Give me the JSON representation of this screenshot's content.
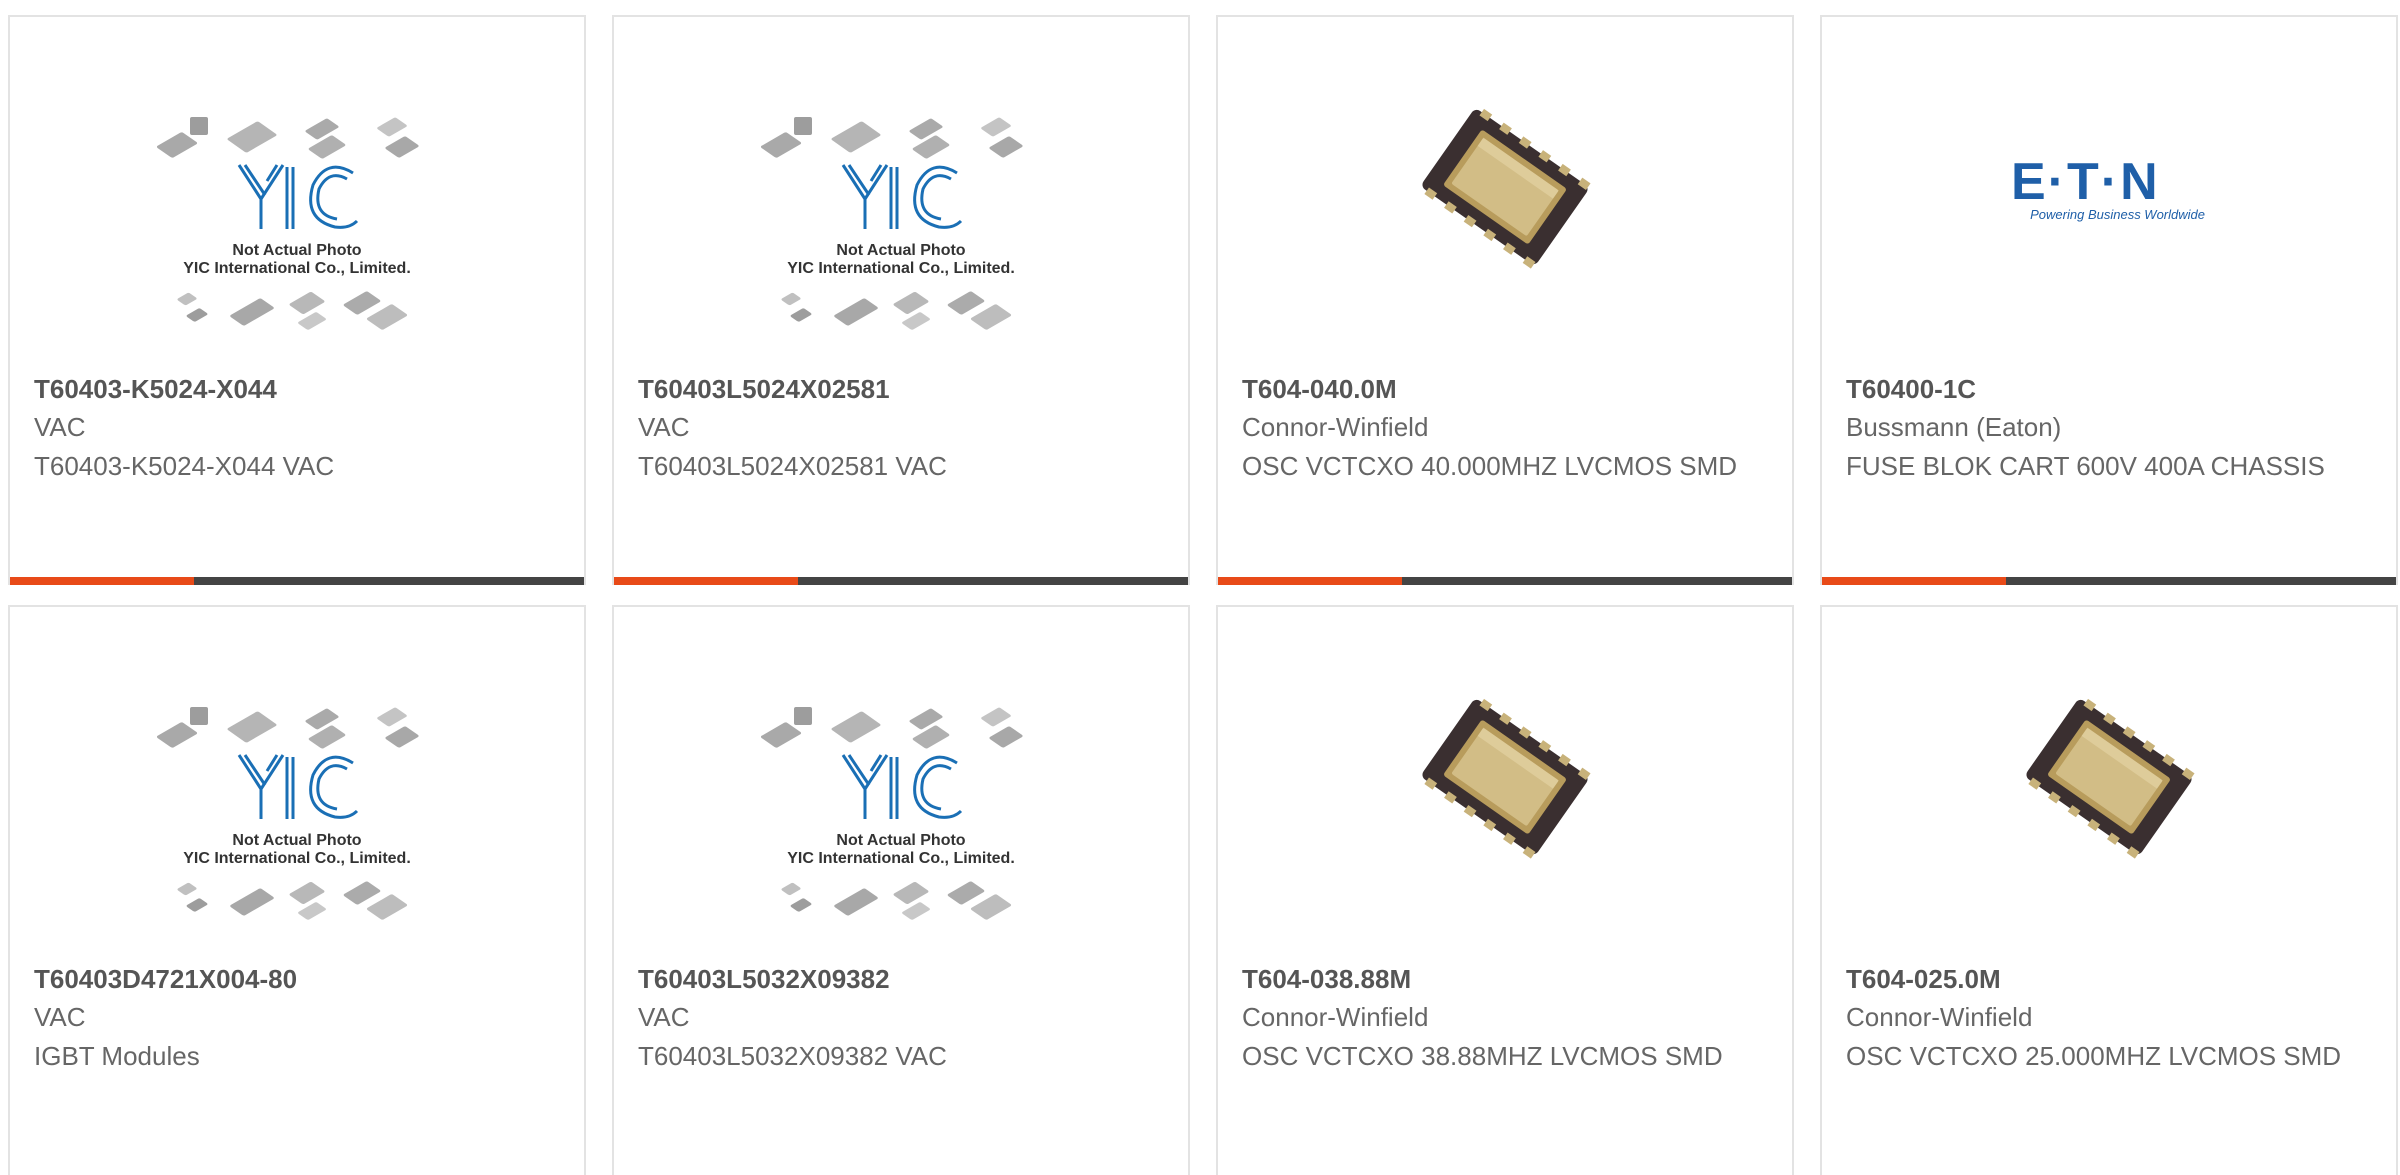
{
  "products": [
    {
      "part": "T60403-K5024-X044",
      "maker": "VAC",
      "desc": "T60403-K5024-X044 VAC",
      "image": "yic-placeholder"
    },
    {
      "part": "T60403L5024X02581",
      "maker": "VAC",
      "desc": "T60403L5024X02581 VAC",
      "image": "yic-placeholder"
    },
    {
      "part": "T604-040.0M",
      "maker": "Connor-Winfield",
      "desc": "OSC VCTCXO 40.000MHZ LVCMOS SMD",
      "image": "oscillator"
    },
    {
      "part": "T60400-1C",
      "maker": "Bussmann (Eaton)",
      "desc": "FUSE BLOK CART 600V 400A CHASSIS",
      "image": "eaton-logo"
    },
    {
      "part": "T60403D4721X004-80",
      "maker": "VAC",
      "desc": "IGBT Modules",
      "image": "yic-placeholder"
    },
    {
      "part": "T60403L5032X09382",
      "maker": "VAC",
      "desc": "T60403L5032X09382 VAC",
      "image": "yic-placeholder"
    },
    {
      "part": "T604-038.88M",
      "maker": "Connor-Winfield",
      "desc": "OSC VCTCXO 38.88MHZ LVCMOS SMD",
      "image": "oscillator"
    },
    {
      "part": "T604-025.0M",
      "maker": "Connor-Winfield",
      "desc": "OSC VCTCXO 25.000MHZ LVCMOS SMD",
      "image": "oscillator"
    }
  ],
  "placeholder": {
    "brand": "YIC",
    "line1": "Not Actual Photo",
    "line2": "YIC International Co., Limited."
  },
  "eaton": {
    "brand": "E·T·N",
    "tagline": "Powering Business Worldwide"
  },
  "colors": {
    "accent": "#e84a18",
    "bar": "#444444",
    "yic_blue": "#1a6fb5",
    "eaton_blue": "#1f5fa8"
  }
}
